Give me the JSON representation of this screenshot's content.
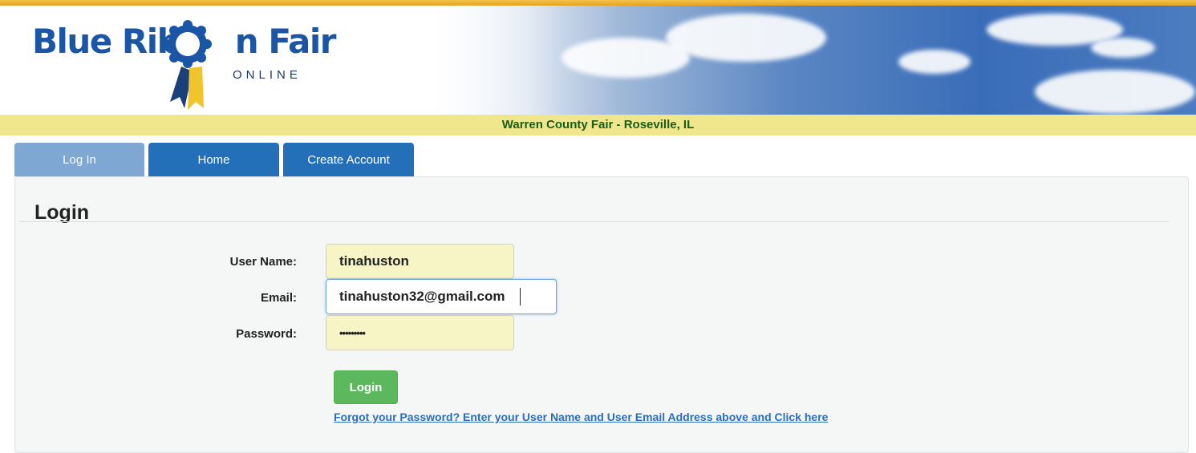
{
  "brand": {
    "logo_text_left": "Blue Ribb",
    "logo_text_right": "n Fair",
    "logo_subtext": "ONLINE"
  },
  "banner": {
    "fair_title": "Warren County Fair - Roseville, IL"
  },
  "nav": {
    "tabs": [
      {
        "label": "Log In",
        "active": true
      },
      {
        "label": "Home",
        "active": false
      },
      {
        "label": "Create Account",
        "active": false
      }
    ]
  },
  "login": {
    "title": "Login",
    "username_label": "User Name:",
    "username_value": "tinahuston",
    "email_label": "Email:",
    "email_value": "tinahuston32@gmail.com",
    "password_label": "Password:",
    "password_value": "•••••••••",
    "submit_label": "Login",
    "forgot_link": "Forgot your Password? Enter your User Name and User Email Address above and Click here"
  },
  "colors": {
    "brand_blue": "#1a56a5",
    "tab_active": "#7ea7d4",
    "tab_inactive": "#2370b9",
    "banner_yellow": "#f0e68c",
    "banner_text": "#1a5c1a",
    "login_green": "#5cb85c",
    "input_fill": "#f7f5c6",
    "link_blue": "#2a6ebd"
  },
  "icons": {
    "logo_mark": "ribbon-rosette-icon"
  }
}
